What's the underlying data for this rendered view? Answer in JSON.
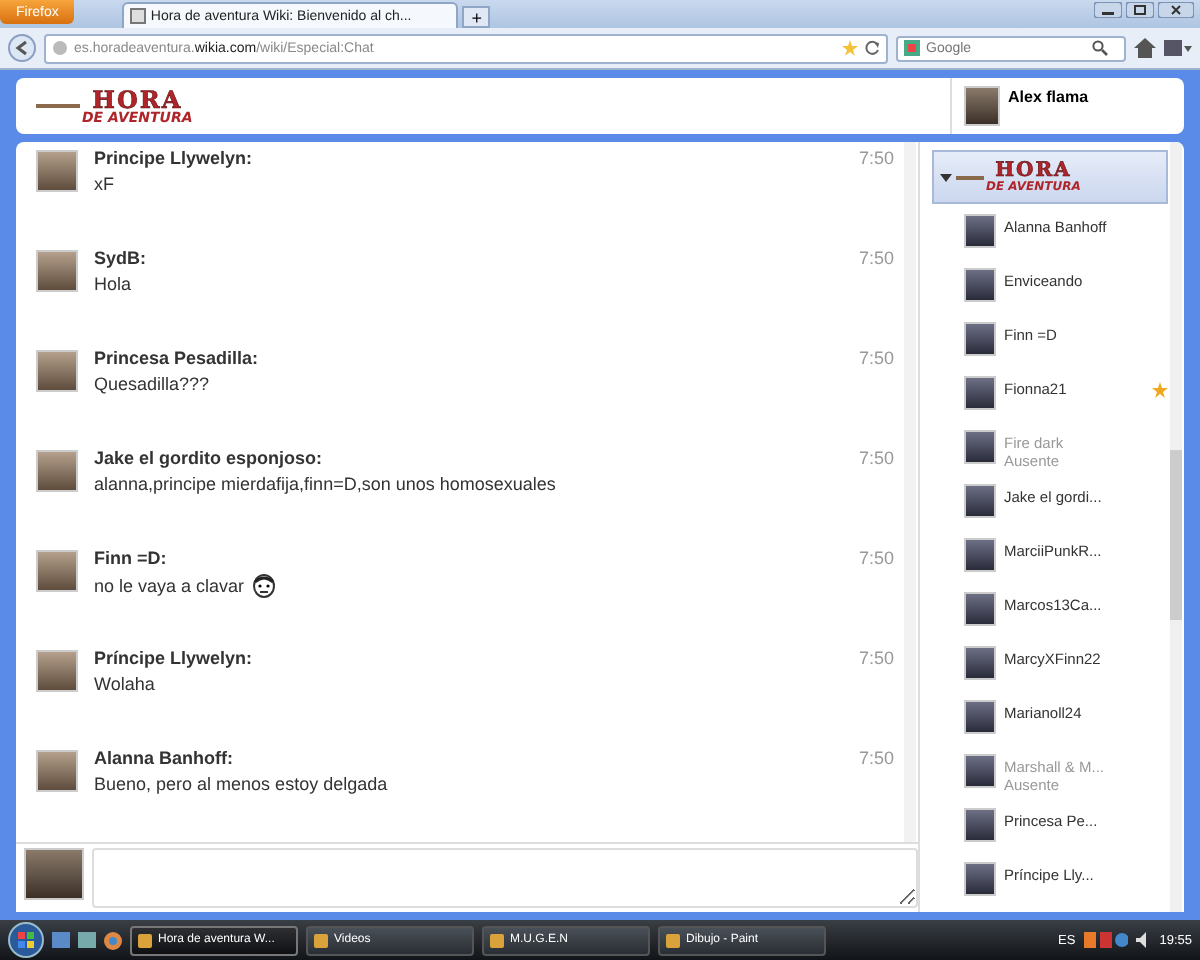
{
  "browser": {
    "menu_button": "Firefox",
    "tab_title": "Hora de aventura Wiki: Bienvenido al ch...",
    "new_tab": "+",
    "url_host": "es.horadeaventura.",
    "url_domain": "wikia.com",
    "url_path": "/wiki/Especial:Chat",
    "search_placeholder": "Google"
  },
  "header": {
    "logo_top": "HORA",
    "logo_bottom": "DE AVENTURA",
    "user_name": "Alex flama"
  },
  "messages": [
    {
      "author": "Principe Llywelyn:",
      "time": "7:50",
      "text": "xF",
      "emoticon": false
    },
    {
      "author": "SydB:",
      "time": "7:50",
      "text": "Hola",
      "emoticon": false
    },
    {
      "author": "Princesa Pesadilla:",
      "time": "7:50",
      "text": "Quesadilla???",
      "emoticon": false
    },
    {
      "author": "Jake el gordito esponjoso:",
      "time": "7:50",
      "text": "alanna,principe mierdafija,finn=D,son unos homosexuales",
      "emoticon": false
    },
    {
      "author": "Finn =D:",
      "time": "7:50",
      "text": "no le vaya a clavar",
      "emoticon": true
    },
    {
      "author": "Príncipe Llywelyn:",
      "time": "7:50",
      "text": "Wolaha",
      "emoticon": false
    },
    {
      "author": "Alanna Banhoff:",
      "time": "7:50",
      "text": "Bueno, pero al menos estoy delgada",
      "emoticon": false
    }
  ],
  "user_list": {
    "logo_top": "HORA",
    "logo_bottom": "DE AVENTURA",
    "users": [
      {
        "name": "Alanna Banhoff",
        "away": false,
        "star": false
      },
      {
        "name": "Enviceando",
        "away": false,
        "star": false
      },
      {
        "name": "Finn =D",
        "away": false,
        "star": false
      },
      {
        "name": "Fionna21",
        "away": false,
        "star": true
      },
      {
        "name": "Fire dark",
        "away": true,
        "status": "Ausente",
        "star": false
      },
      {
        "name": "Jake el gordi...",
        "away": false,
        "star": false
      },
      {
        "name": "MarciiPunkR...",
        "away": false,
        "star": false
      },
      {
        "name": "Marcos13Ca...",
        "away": false,
        "star": false
      },
      {
        "name": "MarcyXFinn22",
        "away": false,
        "star": false
      },
      {
        "name": "Marianoll24",
        "away": false,
        "star": false
      },
      {
        "name": "Marshall & M...",
        "away": true,
        "status": "Ausente",
        "star": false
      },
      {
        "name": "Princesa Pe...",
        "away": false,
        "star": false
      },
      {
        "name": "Príncipe Lly...",
        "away": false,
        "star": false
      }
    ]
  },
  "taskbar": {
    "tasks": [
      {
        "label": "Hora de aventura W...",
        "selected": true
      },
      {
        "label": "Videos",
        "selected": false
      },
      {
        "label": "M.U.G.E.N",
        "selected": false
      },
      {
        "label": "Dibujo - Paint",
        "selected": false
      }
    ],
    "language": "ES",
    "clock": "19:55"
  }
}
